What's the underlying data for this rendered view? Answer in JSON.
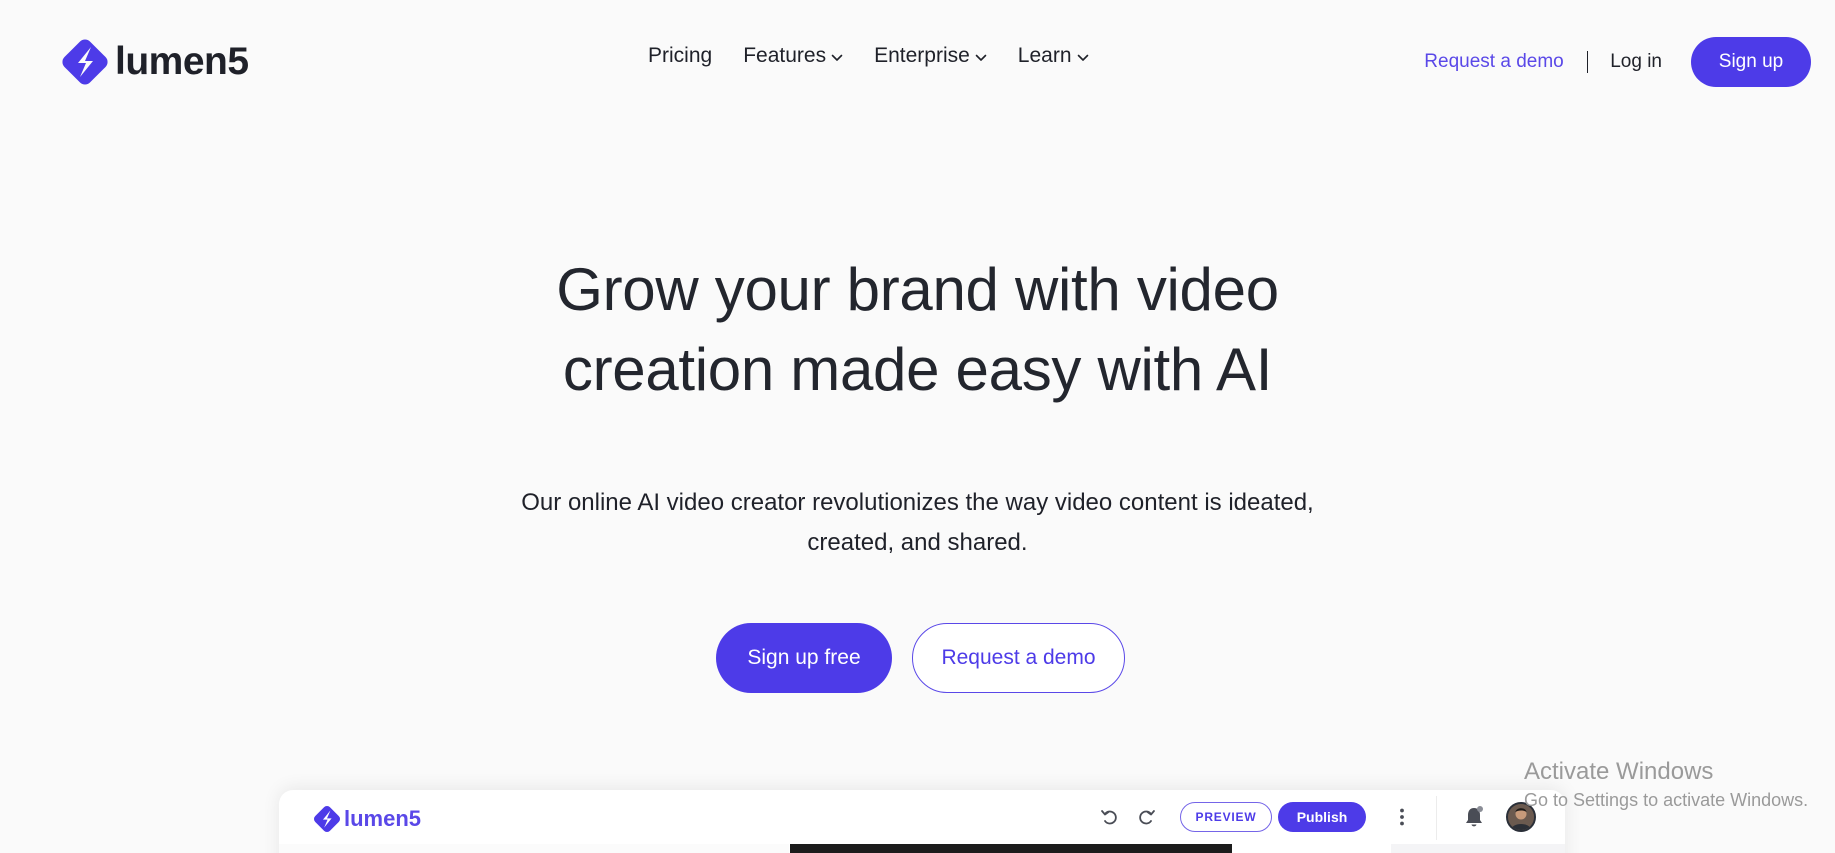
{
  "brand": {
    "name": "lumen5",
    "accent_color": "#4d3be8",
    "logo_icon": "lumen5-logo-icon"
  },
  "nav": {
    "items": [
      {
        "label": "Pricing",
        "has_dropdown": false
      },
      {
        "label": "Features",
        "has_dropdown": true
      },
      {
        "label": "Enterprise",
        "has_dropdown": true
      },
      {
        "label": "Learn",
        "has_dropdown": true
      }
    ],
    "request_demo": "Request a demo",
    "login": "Log in",
    "signup": "Sign up"
  },
  "hero": {
    "title_line1": "Grow your brand with video",
    "title_line2": "creation made easy with AI",
    "subtitle_line1": "Our online AI video creator revolutionizes the way video content is ideated,",
    "subtitle_line2": "created, and shared.",
    "cta_primary": "Sign up free",
    "cta_secondary": "Request a demo"
  },
  "app_preview": {
    "logo_text": "lumen5",
    "preview_label": "PREVIEW",
    "publish_label": "Publish",
    "icons": [
      "undo-icon",
      "redo-icon",
      "kebab-menu-icon",
      "bell-icon",
      "user-avatar"
    ]
  },
  "watermark": {
    "title": "Activate Windows",
    "subtitle": "Go to Settings to activate Windows."
  }
}
